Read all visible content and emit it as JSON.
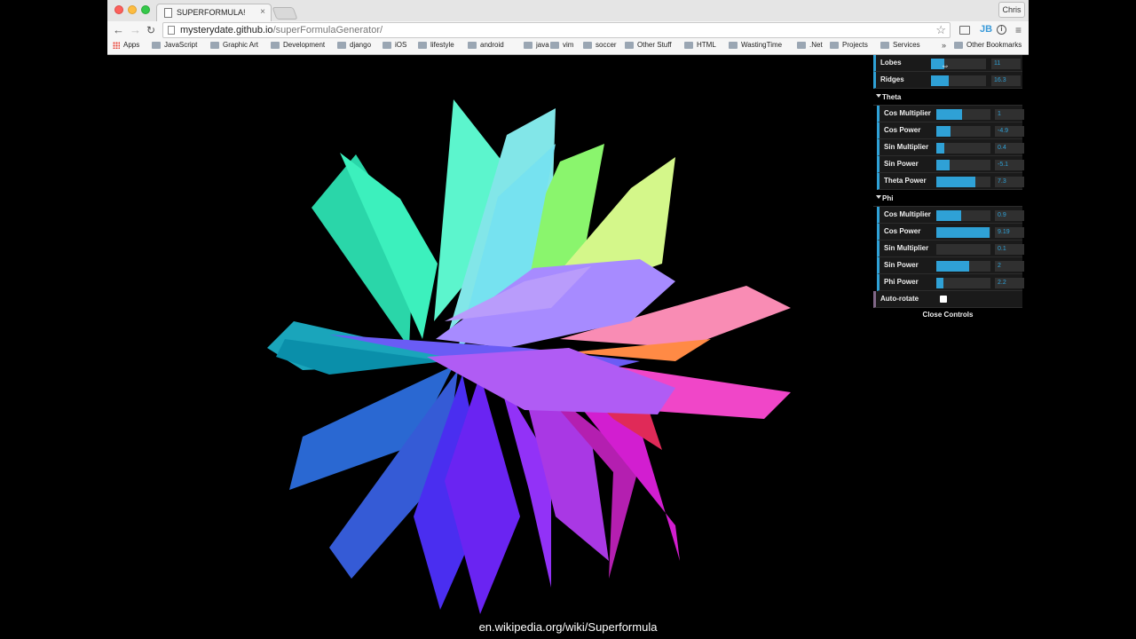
{
  "browser": {
    "tab_title": "SUPERFORMULA!",
    "tab_close": "×",
    "profile_name": "Chris",
    "url_host": "mysterydate.github.io",
    "url_path": "/superFormulaGenerator/",
    "nav": {
      "back": "←",
      "forward": "→",
      "reload": "↻"
    },
    "star": "☆",
    "ext_jb": "JB",
    "info": "i",
    "menu": "≡",
    "bookmarks": [
      {
        "label": "Apps",
        "icon": "apps-grid-icon"
      },
      {
        "label": "JavaScript",
        "icon": "folder-icon"
      },
      {
        "label": "Graphic Art",
        "icon": "folder-icon"
      },
      {
        "label": "Development",
        "icon": "folder-icon"
      },
      {
        "label": "django",
        "icon": "folder-icon"
      },
      {
        "label": "iOS",
        "icon": "folder-icon"
      },
      {
        "label": "lifestyle",
        "icon": "folder-icon"
      },
      {
        "label": "android",
        "icon": "folder-icon"
      },
      {
        "label": "java",
        "icon": "folder-icon"
      },
      {
        "label": "vim",
        "icon": "folder-icon"
      },
      {
        "label": "soccer",
        "icon": "folder-icon"
      },
      {
        "label": "Other Stuff",
        "icon": "folder-icon"
      },
      {
        "label": "HTML",
        "icon": "folder-icon"
      },
      {
        "label": "WastingTime",
        "icon": "folder-icon"
      },
      {
        "label": ".Net",
        "icon": "folder-icon"
      },
      {
        "label": "Projects",
        "icon": "folder-icon"
      },
      {
        "label": "Services",
        "icon": "folder-icon"
      }
    ],
    "bookmarks_more": "»",
    "other_bookmarks": "Other Bookmarks"
  },
  "gui": {
    "top_controls": [
      {
        "label": "Lobes",
        "value": "11",
        "fill": 0.24
      },
      {
        "label": "Ridges",
        "value": "16.3",
        "fill": 0.33
      }
    ],
    "theta": {
      "title": "Theta",
      "controls": [
        {
          "label": "Cos Multiplier",
          "value": "1",
          "fill": 0.48
        },
        {
          "label": "Cos Power",
          "value": "-4.9",
          "fill": 0.27
        },
        {
          "label": "Sin Multiplier",
          "value": "0.4",
          "fill": 0.15
        },
        {
          "label": "Sin Power",
          "value": "-5.1",
          "fill": 0.25
        },
        {
          "label": "Theta Power",
          "value": "7.3",
          "fill": 0.72
        }
      ]
    },
    "phi": {
      "title": "Phi",
      "controls": [
        {
          "label": "Cos Multiplier",
          "value": "0.9",
          "fill": 0.46
        },
        {
          "label": "Cos Power",
          "value": "9.19",
          "fill": 0.98
        },
        {
          "label": "Sin Multiplier",
          "value": "0.1",
          "fill": 0.0
        },
        {
          "label": "Sin Power",
          "value": "2",
          "fill": 0.61
        },
        {
          "label": "Phi Power",
          "value": "2.2",
          "fill": 0.13
        }
      ]
    },
    "auto_rotate_label": "Auto-rotate",
    "auto_rotate": false,
    "close_label": "Close Controls"
  },
  "caption": "en.wikipedia.org/wiki/Superformula",
  "colors": {
    "accent": "#2fa1d6",
    "toggle_accent": "#806787"
  }
}
